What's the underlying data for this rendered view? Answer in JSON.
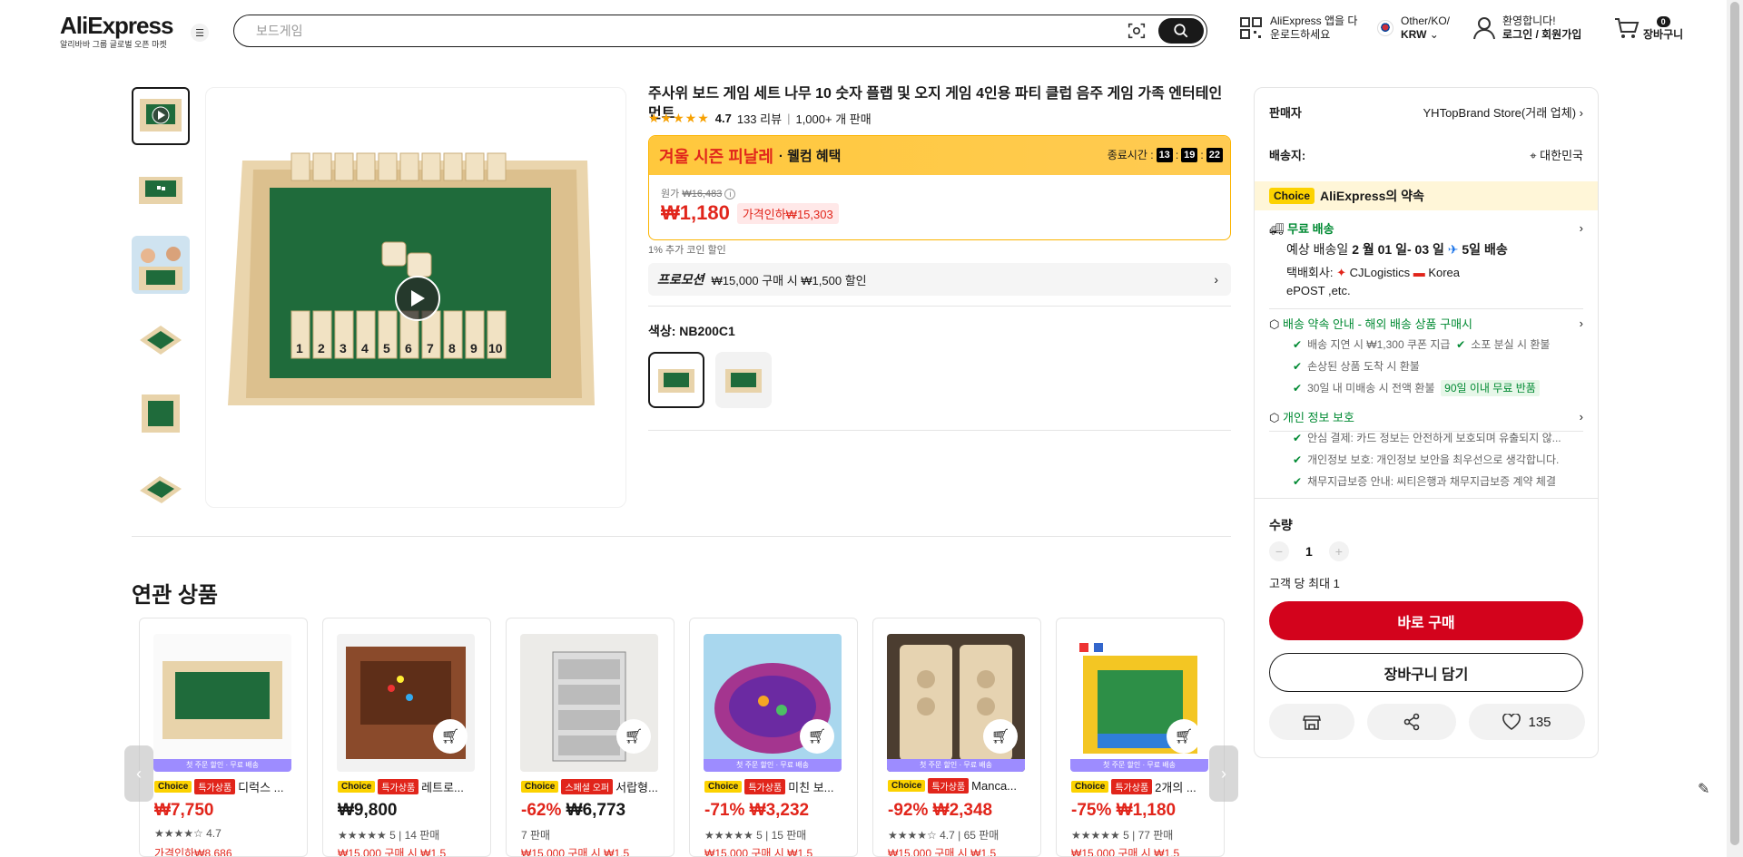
{
  "header": {
    "logo": "AliExpress",
    "logo_sub": "알리바바 그룹 글로벌 오픈 마켓",
    "search_placeholder": "보드게임",
    "app_line1": "AliExpress 앱을 다",
    "app_line2": "운로드하세요",
    "region_line1": "Other/KO/",
    "region_line2": "KRW",
    "welcome": "환영합니다!",
    "login": "로그인 / 회원가입",
    "cart_count": "0",
    "cart_label": "장바구니"
  },
  "product": {
    "title": "주사위 보드 게임 세트 나무 10 숫자 플랩 및 오지 게임 4인용 파티 클럽 음주 게임 가족 엔터테인먼트",
    "stars": "★★★★★",
    "rating": "4.7",
    "reviews": "133 리뷰",
    "sold": "1,000+ 개 판매",
    "promo_title": "겨울 시즌 피날레",
    "promo_sub": "· 웰컴 혜택",
    "timer_label": "종료시간 :",
    "timer_h": "13",
    "timer_m": "19",
    "timer_s": "22",
    "original_label": "원가",
    "original_price": "₩16,483",
    "price": "₩1,180",
    "discount": "가격인하₩15,303",
    "coin": "1% 추가 코인 할인",
    "promotion_label": "프로모션",
    "promotion_text": "₩15,000 구매 시 ₩1,500 할인",
    "color_label": "색상: NB200C1"
  },
  "panel": {
    "seller_label": "판매자",
    "seller_name": "YHTopBrand Store(거래 업체)",
    "ship_label": "배송지:",
    "ship_to": "대한민국",
    "choice_chip": "Choice",
    "choice_text": "AliExpress의 약속",
    "free_ship": "무료 배송",
    "delivery_prefix": "예상 배송일",
    "delivery_date": "2 월 01 일- 03 일",
    "delivery_days": "5일 배송",
    "courier_label": "택배회사:",
    "courier1": "CJLogistics",
    "courier2": "Korea",
    "courier3": "ePOST ,etc.",
    "promise_title": "배송 약속 안내 - 해외 배송 상품 구매시",
    "promise1": "배송 지연 시 ₩1,300 쿠폰 지급",
    "promise2": "소포 분실 시 환불",
    "promise3": "손상된 상품 도착 시 환불",
    "promise4": "30일 내 미배송 시 전액 환불",
    "promise4_badge": "90일 이내 무료 반품",
    "privacy_title": "개인 정보 보호",
    "privacy1": "안심 결제: 카드 정보는 안전하게 보호되며 유출되지 않...",
    "privacy2": "개인정보 보호: 개인정보 보안을 최우선으로 생각합니다.",
    "privacy3": "채무지급보증 안내: 씨티은행과 채무지급보증 계약 체결",
    "qty_label": "수량",
    "qty_minus": "−",
    "qty_value": "1",
    "qty_plus": "+",
    "qty_limit": "고객 당 최대 1",
    "buy_now": "바로 구매",
    "add_cart": "장바구니 담기",
    "wish_count": "135"
  },
  "related": {
    "title": "연관 상품",
    "items": [
      {
        "choice": "Choice",
        "tag": "특가상품",
        "name": "디럭스 ...",
        "disc": "",
        "price": "₩7,750",
        "rating": "★★★★☆ 4.7",
        "extra": "가격인하₩8,686",
        "strip": "첫 주문 할인 · 무료 배송"
      },
      {
        "choice": "Choice",
        "tag": "특가상품",
        "name": "레트로...",
        "disc": "",
        "price": "₩9,800",
        "rating": "★★★★★ 5 | 14 판매",
        "extra": "₩15,000 구매 시 ₩1,5",
        "strip": ""
      },
      {
        "choice": "Choice",
        "tag": "스페셜 오퍼",
        "name": "서랍형...",
        "disc": "-62%",
        "price": "₩6,773",
        "rating": "7 판매",
        "extra": "₩15,000 구매 시 ₩1,5",
        "strip": ""
      },
      {
        "choice": "Choice",
        "tag": "특가상품",
        "name": "미친 보...",
        "disc": "-71%",
        "price": "₩3,232",
        "rating": "★★★★★ 5 | 15 판매",
        "extra": "₩15,000 구매 시 ₩1,5",
        "strip": "첫 주문 할인 · 무료 배송"
      },
      {
        "choice": "Choice",
        "tag": "특가상품",
        "name": "Manca...",
        "disc": "-92%",
        "price": "₩2,348",
        "rating": "★★★★☆ 4.7 | 65 판매",
        "extra": "₩15,000 구매 시 ₩1,5",
        "strip": "첫 주문 할인 · 무료 배송"
      },
      {
        "choice": "Choice",
        "tag": "특가상품",
        "name": "2개의 ...",
        "disc": "-75%",
        "price": "₩1,180",
        "rating": "★★★★★ 5 | 77 판매",
        "extra": "₩15,000 구매 시 ₩1,5",
        "strip": "첫 주문 할인 · 무료 배송"
      }
    ]
  },
  "colors": {
    "accent_red": "#e1251b",
    "buy_red": "#d3031c",
    "choice_yellow": "#fcd200",
    "green": "#018a33"
  }
}
